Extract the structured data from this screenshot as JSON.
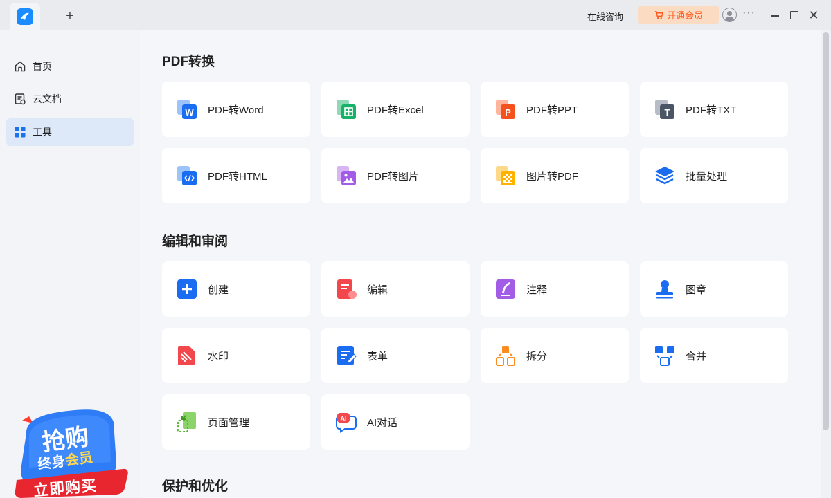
{
  "titlebar": {
    "new_tab": "+",
    "consult": "在线咨询",
    "vip": "开通会员",
    "more": "···",
    "close": "✕"
  },
  "sidebar": {
    "items": [
      {
        "label": "首页",
        "icon": "home-icon"
      },
      {
        "label": "云文档",
        "icon": "cloud-doc-icon"
      },
      {
        "label": "工具",
        "icon": "tools-grid-icon",
        "active": true
      }
    ]
  },
  "promo": {
    "line1": "抢购",
    "line2a": "终身",
    "line2b": "会员",
    "cta": "立即购买"
  },
  "sections": [
    {
      "title": "PDF转换",
      "tools": [
        {
          "label": "PDF转Word",
          "icon": "pdf-to-word-icon"
        },
        {
          "label": "PDF转Excel",
          "icon": "pdf-to-excel-icon"
        },
        {
          "label": "PDF转PPT",
          "icon": "pdf-to-ppt-icon"
        },
        {
          "label": "PDF转TXT",
          "icon": "pdf-to-txt-icon"
        },
        {
          "label": "PDF转HTML",
          "icon": "pdf-to-html-icon"
        },
        {
          "label": "PDF转图片",
          "icon": "pdf-to-image-icon"
        },
        {
          "label": "图片转PDF",
          "icon": "image-to-pdf-icon"
        },
        {
          "label": "批量处理",
          "icon": "batch-icon"
        }
      ]
    },
    {
      "title": "编辑和审阅",
      "tools": [
        {
          "label": "创建",
          "icon": "create-icon"
        },
        {
          "label": "编辑",
          "icon": "edit-icon"
        },
        {
          "label": "注释",
          "icon": "annotate-icon"
        },
        {
          "label": "图章",
          "icon": "stamp-icon"
        },
        {
          "label": "水印",
          "icon": "watermark-icon"
        },
        {
          "label": "表单",
          "icon": "form-icon"
        },
        {
          "label": "拆分",
          "icon": "split-icon"
        },
        {
          "label": "合并",
          "icon": "merge-icon"
        },
        {
          "label": "页面管理",
          "icon": "page-manage-icon"
        },
        {
          "label": "AI对话",
          "icon": "ai-chat-icon"
        }
      ]
    },
    {
      "title": "保护和优化",
      "tools": []
    }
  ],
  "colors": {
    "accent": "#1a73e8",
    "vip_text": "#ff5a1f",
    "vip_bg": "#fbdcc3"
  }
}
